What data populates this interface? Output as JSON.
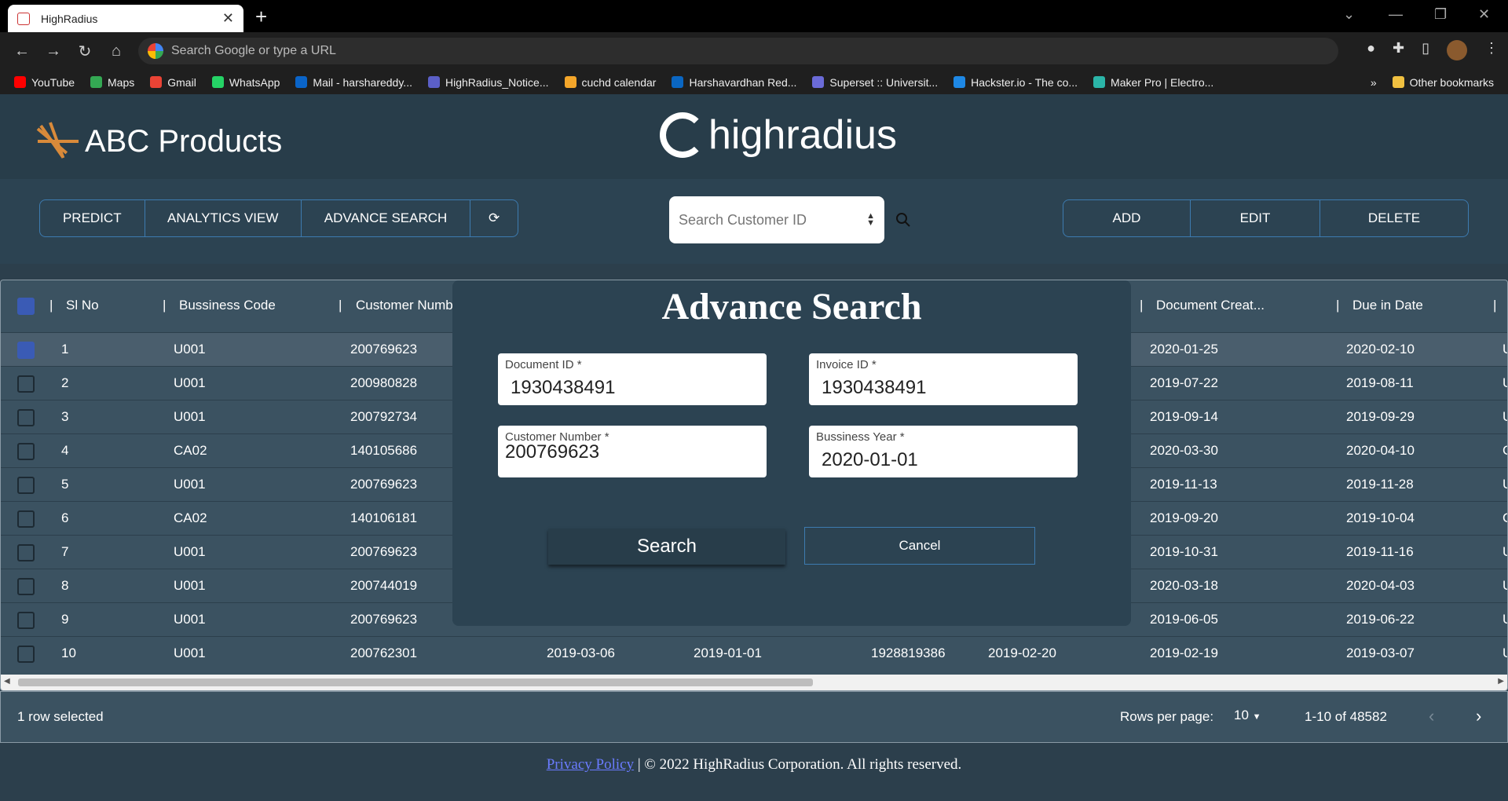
{
  "browser": {
    "tab_title": "HighRadius",
    "new_tab": "+",
    "address_placeholder": "Search Google or type a URL",
    "bookmarks": [
      {
        "label": "YouTube",
        "color": "#ff0000"
      },
      {
        "label": "Maps",
        "color": "#34a853"
      },
      {
        "label": "Gmail",
        "color": "#ea4335"
      },
      {
        "label": "WhatsApp",
        "color": "#25d366"
      },
      {
        "label": "Mail - harshareddy...",
        "color": "#0a64c8"
      },
      {
        "label": "HighRadius_Notice...",
        "color": "#5b5fc7"
      },
      {
        "label": "cuchd calendar",
        "color": "#f4a62a"
      },
      {
        "label": "Harshavardhan Red...",
        "color": "#0a66c2"
      },
      {
        "label": "Superset :: Universit...",
        "color": "#6b6bd8"
      },
      {
        "label": "Hackster.io - The co...",
        "color": "#1e88e5"
      },
      {
        "label": "Maker Pro | Electro...",
        "color": "#2bb5a8"
      }
    ],
    "more": "»",
    "other_bookmarks": "Other bookmarks"
  },
  "header": {
    "brand": "ABC Products",
    "logo_text": "highradius"
  },
  "toolbar": {
    "left_buttons": [
      "PREDICT",
      "ANALYTICS VIEW",
      "ADVANCE SEARCH"
    ],
    "refresh_icon": "refresh-icon",
    "search_placeholder": "Search Customer ID",
    "right_buttons": [
      "ADD",
      "EDIT",
      "DELETE"
    ]
  },
  "table": {
    "headers": [
      "Sl No",
      "Bussiness Code",
      "Customer Numb",
      "Document Creat...",
      "Due in Date"
    ],
    "rows": [
      {
        "sl": "1",
        "code": "U001",
        "cust": "200769623",
        "doc": "2020-01-25",
        "due": "2020-02-10",
        "tail": "U",
        "checked": true
      },
      {
        "sl": "2",
        "code": "U001",
        "cust": "200980828",
        "doc": "2019-07-22",
        "due": "2019-08-11",
        "tail": "U",
        "checked": false
      },
      {
        "sl": "3",
        "code": "U001",
        "cust": "200792734",
        "doc": "2019-09-14",
        "due": "2019-09-29",
        "tail": "U",
        "checked": false
      },
      {
        "sl": "4",
        "code": "CA02",
        "cust": "140105686",
        "doc": "2020-03-30",
        "due": "2020-04-10",
        "tail": "C",
        "checked": false
      },
      {
        "sl": "5",
        "code": "U001",
        "cust": "200769623",
        "doc": "2019-11-13",
        "due": "2019-11-28",
        "tail": "U",
        "checked": false
      },
      {
        "sl": "6",
        "code": "CA02",
        "cust": "140106181",
        "doc": "2019-09-20",
        "due": "2019-10-04",
        "tail": "C",
        "checked": false
      },
      {
        "sl": "7",
        "code": "U001",
        "cust": "200769623",
        "doc": "2019-10-31",
        "due": "2019-11-16",
        "tail": "U",
        "checked": false
      },
      {
        "sl": "8",
        "code": "U001",
        "cust": "200744019",
        "doc": "2020-03-18",
        "due": "2020-04-03",
        "tail": "U",
        "checked": false
      },
      {
        "sl": "9",
        "code": "U001",
        "cust": "200769623",
        "doc": "2019-06-05",
        "due": "2019-06-22",
        "tail": "U",
        "checked": false
      },
      {
        "sl": "10",
        "code": "U001",
        "cust": "200762301",
        "doc": "2019-02-19",
        "due": "2019-03-07",
        "tail": "U",
        "checked": false
      }
    ],
    "row10_extra": [
      "2019-03-06",
      "2019-01-01",
      "1928819386",
      "2019-02-20"
    ]
  },
  "pagination": {
    "selected_text": "1 row selected",
    "rows_per_page_label": "Rows per page:",
    "rows_per_page": "10",
    "range": "1-10 of 48582"
  },
  "footer": {
    "privacy": "Privacy Policy",
    "copyright": " | © 2022 HighRadius Corporation. All rights reserved."
  },
  "modal": {
    "title": "Advance Search",
    "document_id_label": "Document ID *",
    "document_id": "1930438491",
    "invoice_id_label": "Invoice ID *",
    "invoice_id": "1930438491",
    "customer_number_label": "Customer Number *",
    "customer_number": "200769623",
    "business_year_label": "Bussiness Year *",
    "business_year": "2020-01-01",
    "search_label": "Search",
    "cancel_label": "Cancel"
  }
}
